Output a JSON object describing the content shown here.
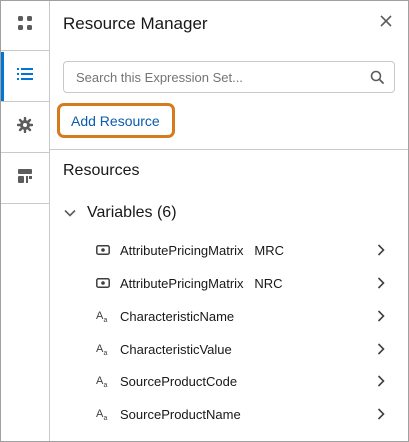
{
  "rail": {
    "items": [
      {
        "icon": "apps-grid-icon",
        "active": false
      },
      {
        "icon": "list-icon",
        "active": true
      },
      {
        "icon": "settings-gear-icon",
        "active": false
      },
      {
        "icon": "layout-component-icon",
        "active": false
      }
    ]
  },
  "panel": {
    "title": "Resource Manager",
    "search": {
      "placeholder": "Search this Expression Set...",
      "value": ""
    },
    "add_resource_label": "Add Resource",
    "section_title": "Resources",
    "group": {
      "label": "Variables (6)",
      "expanded": true
    },
    "resources": [
      {
        "icon": "matrix-icon",
        "name": "AttributePricingMatrix   MRC"
      },
      {
        "icon": "matrix-icon",
        "name": "AttributePricingMatrix   NRC"
      },
      {
        "icon": "text-type-icon",
        "name": "CharacteristicName"
      },
      {
        "icon": "text-type-icon",
        "name": "CharacteristicValue"
      },
      {
        "icon": "text-type-icon",
        "name": "SourceProductCode"
      },
      {
        "icon": "text-type-icon",
        "name": "SourceProductName"
      }
    ]
  },
  "colors": {
    "accent": "#0176d3",
    "link": "#0b5cab",
    "highlight_border": "#d67a1e",
    "border": "#c9c9c9"
  }
}
